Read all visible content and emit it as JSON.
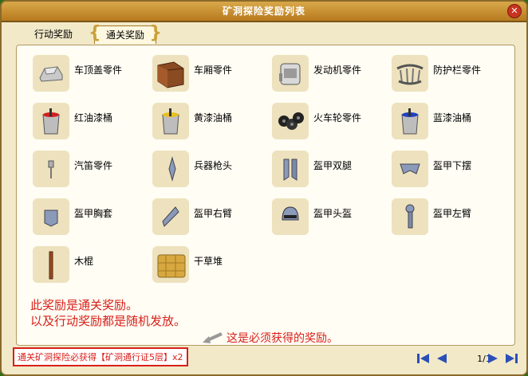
{
  "window": {
    "title": "矿洞探险奖励列表"
  },
  "tabs": [
    {
      "label": "行动奖励",
      "active": false
    },
    {
      "label": "通关奖励",
      "active": true
    }
  ],
  "items": [
    {
      "name": "车顶盖零件",
      "icon": "roof-part-icon"
    },
    {
      "name": "车厢零件",
      "icon": "wagon-box-icon"
    },
    {
      "name": "发动机零件",
      "icon": "engine-part-icon"
    },
    {
      "name": "防护栏零件",
      "icon": "guardrail-icon"
    },
    {
      "name": "红油漆桶",
      "icon": "red-paint-bucket-icon"
    },
    {
      "name": "黄漆油桶",
      "icon": "yellow-paint-bucket-icon"
    },
    {
      "name": "火车轮零件",
      "icon": "train-wheels-icon"
    },
    {
      "name": "蓝漆油桶",
      "icon": "blue-paint-bucket-icon"
    },
    {
      "name": "汽笛零件",
      "icon": "whistle-icon"
    },
    {
      "name": "兵器枪头",
      "icon": "spearhead-icon"
    },
    {
      "name": "盔甲双腿",
      "icon": "armor-legs-icon"
    },
    {
      "name": "盔甲下摆",
      "icon": "armor-skirt-icon"
    },
    {
      "name": "盔甲胸套",
      "icon": "armor-chest-icon"
    },
    {
      "name": "盔甲右臂",
      "icon": "armor-right-arm-icon"
    },
    {
      "name": "盔甲头盔",
      "icon": "armor-helmet-icon"
    },
    {
      "name": "盔甲左臂",
      "icon": "armor-left-arm-icon"
    },
    {
      "name": "木棍",
      "icon": "wooden-stick-icon"
    },
    {
      "name": "干草堆",
      "icon": "haystack-icon"
    }
  ],
  "notes": {
    "line1": "此奖励是通关奖励。",
    "line2": "以及行动奖励都是随机发放。",
    "hint": "这是必须获得的奖励。"
  },
  "footer": {
    "text": "通关矿洞探险必获得【矿洞通行证5层】x2"
  },
  "pager": {
    "label": "1/1"
  }
}
